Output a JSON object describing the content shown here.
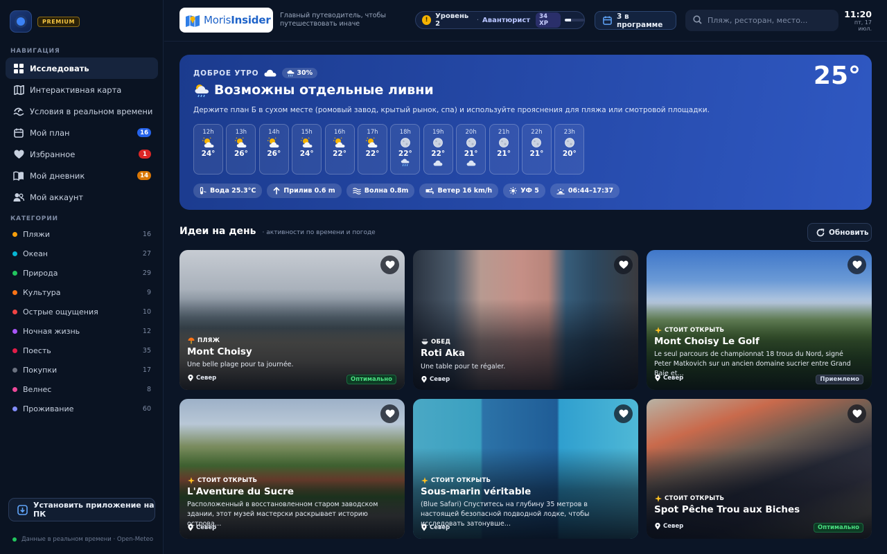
{
  "sidebar": {
    "premium": "PREMIUM",
    "nav_title": "НАВИГАЦИЯ",
    "nav": [
      {
        "label": "Исследовать",
        "badge": ""
      },
      {
        "label": "Интерактивная карта",
        "badge": ""
      },
      {
        "label": "Условия в реальном времени",
        "badge": ""
      },
      {
        "label": "Мой план",
        "badge": "16"
      },
      {
        "label": "Избранное",
        "badge": "1"
      },
      {
        "label": "Мой дневник",
        "badge": "14"
      },
      {
        "label": "Мой аккаунт",
        "badge": ""
      }
    ],
    "cat_title": "КАТЕГОРИИ",
    "categories": [
      {
        "label": "Пляжи",
        "count": "16",
        "color": "#f59e0b"
      },
      {
        "label": "Океан",
        "count": "27",
        "color": "#06b6d4"
      },
      {
        "label": "Природа",
        "count": "29",
        "color": "#22c55e"
      },
      {
        "label": "Культура",
        "count": "9",
        "color": "#f97316"
      },
      {
        "label": "Острые ощущения",
        "count": "10",
        "color": "#ef4444"
      },
      {
        "label": "Ночная жизнь",
        "count": "12",
        "color": "#a855f7"
      },
      {
        "label": "Поесть",
        "count": "35",
        "color": "#e11d48"
      },
      {
        "label": "Покупки",
        "count": "17",
        "color": "#6b7280"
      },
      {
        "label": "Велнес",
        "count": "8",
        "color": "#ec4899"
      },
      {
        "label": "Проживание",
        "count": "60",
        "color": "#818cf8"
      }
    ],
    "install": "Установить приложение на ПК",
    "footer": "Данные в реальном времени · Open-Meteo"
  },
  "header": {
    "brand_a": "Moris",
    "brand_b": "Insider",
    "tagline": "Главный путеводитель, чтобы путешествовать иначе",
    "level": "Уровень 2",
    "rank": "Авантюрист",
    "xp": "34 XP",
    "xp_fraction": 0.34,
    "plan": "3 в программе",
    "search_placeholder": "Пляж, ресторан, место...",
    "time": "11:20",
    "date": "пт, 17 июл."
  },
  "weather": {
    "greeting": "ДОБРОЕ УТРО",
    "rain": "30%",
    "temp": "25°",
    "condition": "Возможны отдельные ливни",
    "advice": "Держите план Б в сухом месте (ромовый завод, крытый рынок, спа) и используйте прояснения для пляжа или смотровой площадки.",
    "hours": [
      {
        "h": "12h",
        "t": "24°",
        "icon": "sun-cloud",
        "extra": ""
      },
      {
        "h": "13h",
        "t": "26°",
        "icon": "sun-cloud",
        "extra": ""
      },
      {
        "h": "14h",
        "t": "26°",
        "icon": "sun-cloud",
        "extra": ""
      },
      {
        "h": "15h",
        "t": "24°",
        "icon": "sun-cloud",
        "extra": ""
      },
      {
        "h": "16h",
        "t": "22°",
        "icon": "sun-cloud",
        "extra": ""
      },
      {
        "h": "17h",
        "t": "22°",
        "icon": "sun-cloud",
        "extra": ""
      },
      {
        "h": "18h",
        "t": "22°",
        "icon": "moon",
        "extra": "rain"
      },
      {
        "h": "19h",
        "t": "22°",
        "icon": "moon",
        "extra": "cloud"
      },
      {
        "h": "20h",
        "t": "21°",
        "icon": "moon",
        "extra": "cloud"
      },
      {
        "h": "21h",
        "t": "21°",
        "icon": "moon",
        "extra": ""
      },
      {
        "h": "22h",
        "t": "21°",
        "icon": "moon",
        "extra": ""
      },
      {
        "h": "23h",
        "t": "20°",
        "icon": "moon",
        "extra": ""
      }
    ],
    "chips": [
      {
        "label": "Вода 25.3°C",
        "icon": "thermometer"
      },
      {
        "label": "Прилив 0.6 m",
        "icon": "arrow-up"
      },
      {
        "label": "Волна 0.8m",
        "icon": "waves"
      },
      {
        "label": "Ветер 16 km/h",
        "icon": "wind"
      },
      {
        "label": "УФ 5",
        "icon": "sun"
      },
      {
        "label": "06:44–17:37",
        "icon": "sunrise"
      }
    ]
  },
  "ideas": {
    "title": "Идеи на день",
    "subtitle": "· активности по времени и погоде",
    "refresh": "Обновить",
    "cards": [
      {
        "tag": "ПЛЯЖ",
        "title": "Mont Choisy",
        "desc": "Une belle plage pour ta journée.",
        "loc": "Север",
        "status": "Оптимально",
        "status_kind": "good"
      },
      {
        "tag": "ОБЕД",
        "title": "Roti Aka",
        "desc": "Une table pour te régaler.",
        "loc": "Север",
        "status": "",
        "status_kind": ""
      },
      {
        "tag": "СТОИТ ОТКРЫТЬ",
        "title": "Mont Choisy Le Golf",
        "desc": "Le seul parcours de championnat 18 trous du Nord, signé Peter Matkovich sur un ancien domaine sucrier entre Grand Baie et…",
        "loc": "Север",
        "status": "Приемлемо",
        "status_kind": "ok"
      },
      {
        "tag": "СТОИТ ОТКРЫТЬ",
        "title": "L'Aventure du Sucre",
        "desc": "Расположенный в восстановленном старом заводском здании, этот музей мастерски раскрывает историю острова…",
        "loc": "Север",
        "status": "",
        "status_kind": ""
      },
      {
        "tag": "СТОИТ ОТКРЫТЬ",
        "title": "Sous-marin véritable",
        "desc": "(Blue Safari) Спуститесь на глубину 35 метров в настоящей безопасной подводной лодке, чтобы исследовать затонувше…",
        "loc": "Север",
        "status": "",
        "status_kind": ""
      },
      {
        "tag": "СТОИТ ОТКРЫТЬ",
        "title": "Spot Pêche Trou aux Biches",
        "desc": "",
        "loc": "Север",
        "status": "Оптимально",
        "status_kind": "good"
      }
    ]
  }
}
